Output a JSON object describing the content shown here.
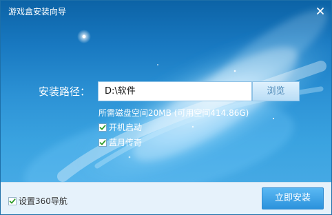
{
  "window": {
    "title": "游戏盒安装向导",
    "close_icon": "close-icon"
  },
  "install": {
    "path_label": "安装路径：",
    "path_value": "D:\\软件",
    "browse_label": "浏览",
    "space_info": "所需磁盘空间20MB (可用空间414.86G)"
  },
  "options": [
    {
      "label": "开机启动",
      "checked": true
    },
    {
      "label": "蓝月传奇",
      "checked": true
    }
  ],
  "footer": {
    "nav_label": "设置360导航",
    "nav_checked": true,
    "install_label": "立即安装"
  },
  "colors": {
    "hero_dark": "#0c63a6",
    "hero_light": "#45a9e4",
    "check_green": "#2d9b27",
    "footer_bg": "#e6f2fb",
    "install_button": "#2b92dc"
  }
}
